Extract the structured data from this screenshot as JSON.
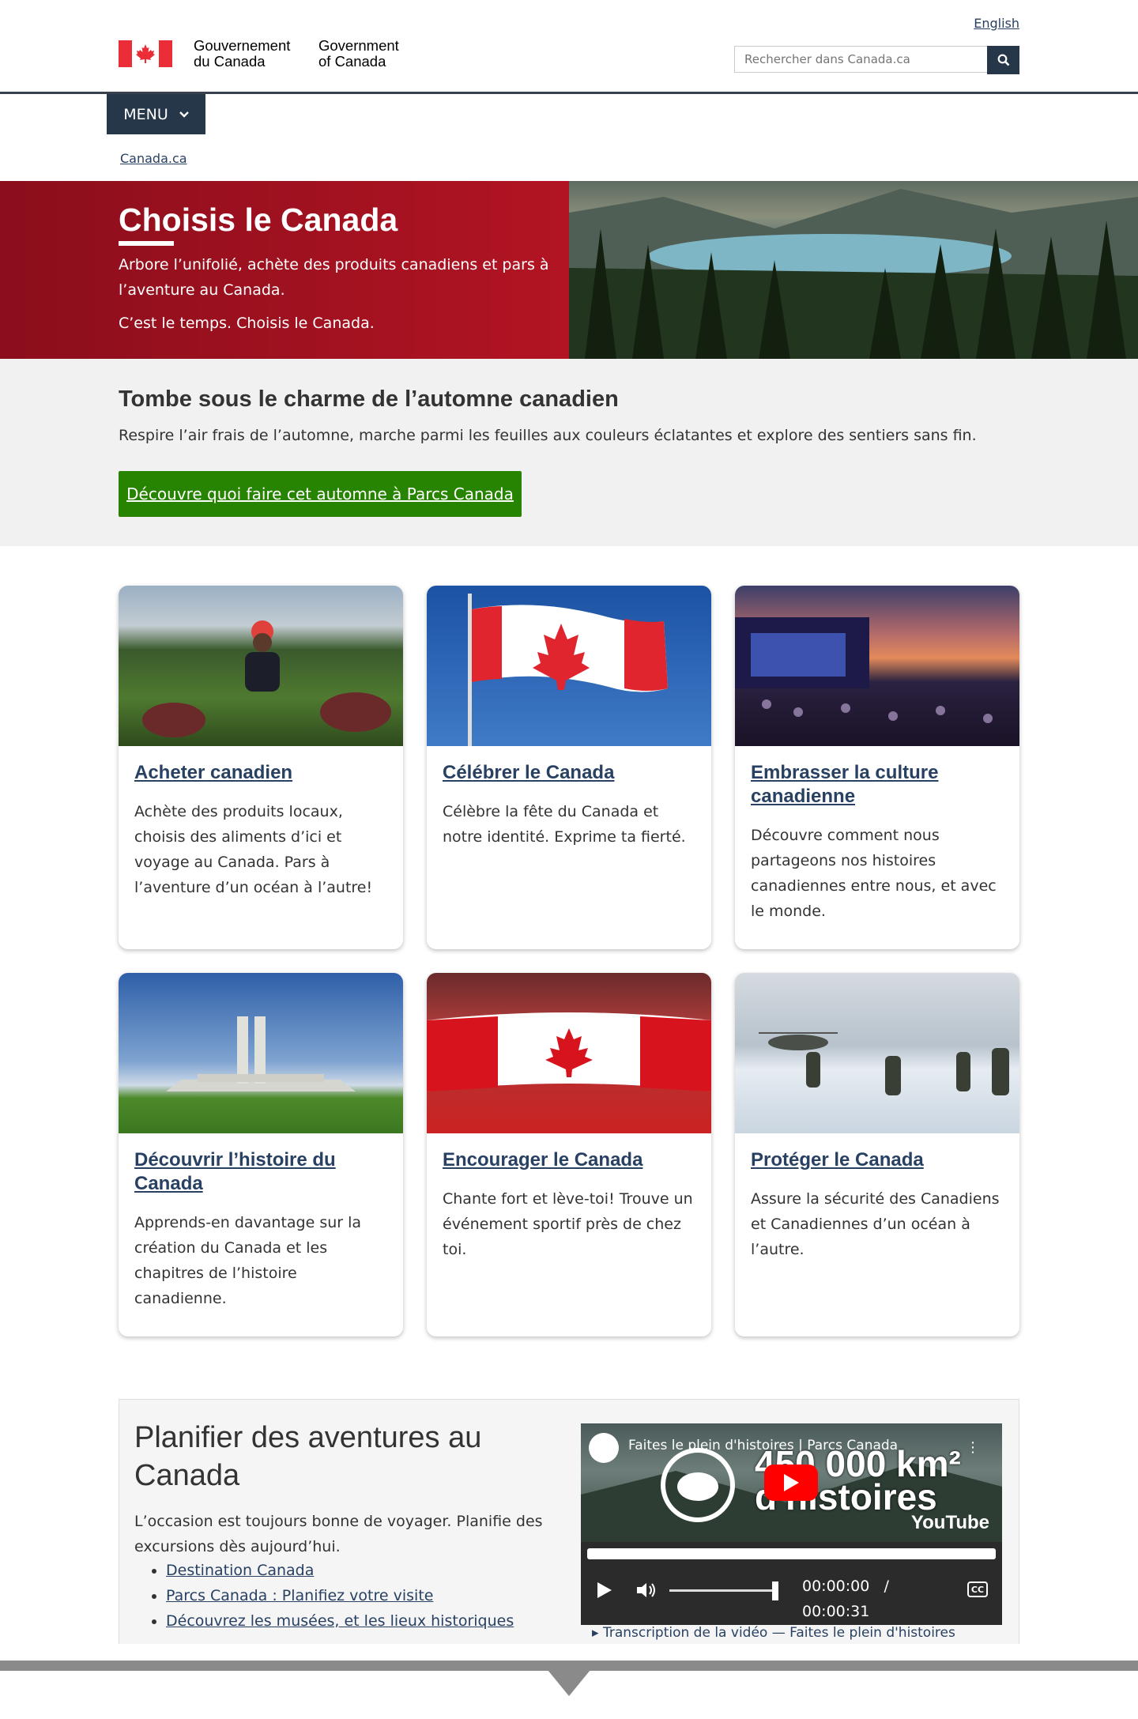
{
  "header": {
    "lang_link": "English",
    "signature_fr": "Gouvernement\ndu Canada",
    "signature_en": "Government\nof Canada",
    "search_placeholder": "Rechercher dans Canada.ca",
    "menu_label": "MENU"
  },
  "breadcrumb": {
    "home": "Canada.ca"
  },
  "hero": {
    "title": "Choisis le Canada",
    "text1": "Arbore l’unifolié, achète des produits canadiens et pars à l’aventure au Canada.",
    "text2": "C’est le temps. Choisis le Canada."
  },
  "autumn": {
    "title": "Tombe sous le charme de l’automne canadien",
    "text": "Respire l’air frais de l’automne, marche parmi les feuilles aux couleurs éclatantes et explore des sentiers sans fin.",
    "button": "Découvre quoi faire cet automne à Parcs Canada"
  },
  "cards": [
    {
      "title": "Acheter canadien",
      "text": "Achète des produits locaux, choisis des aliments d’ici et voyage au Canada. Pars à l’aventure d’un océan à l’autre!"
    },
    {
      "title": "Célébrer le Canada",
      "text": "Célèbre la fête du Canada et notre identité. Exprime ta fierté."
    },
    {
      "title": "Embrasser la culture canadienne",
      "text": "Découvre comment nous partageons nos histoires canadiennes entre nous, et avec le monde."
    },
    {
      "title": "Découvrir l’histoire du Canada",
      "text": "Apprends-en davantage sur la création du Canada et les chapitres de l’histoire canadienne."
    },
    {
      "title": "Encourager le Canada",
      "text": "Chante fort et lève-toi! Trouve un événement sportif près de chez toi."
    },
    {
      "title": "Protéger le Canada",
      "text": "Assure la sécurité des Canadiens et Canadiennes d’un océan à l’autre."
    }
  ],
  "plan": {
    "title": "Planifier des aventures au Canada",
    "intro": "L’occasion est toujours bonne de voyager. Planifie des excursions dès aujourd’hui.",
    "links": [
      "Destination Canada",
      "Parcs Canada : Planifiez votre visite",
      "Découvrez les musées, et les lieux historiques"
    ],
    "video": {
      "title": "Faites le plein d'histoires | Parcs Canada",
      "thumb_text": "450 000 km²\nd'histoires",
      "youtube": "YouTube",
      "current_time": "00:00:00",
      "separator": "/",
      "duration": "00:00:31",
      "transcript": "Transcription de la vidéo — Faites le plein d'histoires"
    }
  }
}
